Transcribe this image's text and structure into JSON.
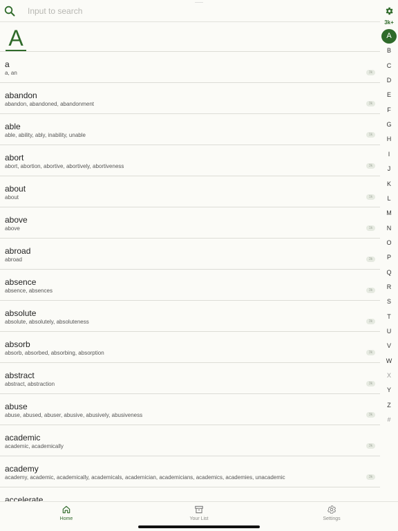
{
  "search": {
    "placeholder": "Input to search"
  },
  "rail": {
    "count": "3k+",
    "letters": [
      "A",
      "B",
      "C",
      "D",
      "E",
      "F",
      "G",
      "H",
      "I",
      "J",
      "K",
      "L",
      "M",
      "N",
      "O",
      "P",
      "Q",
      "R",
      "S",
      "T",
      "U",
      "V",
      "W",
      "X",
      "Y",
      "Z",
      "#"
    ],
    "active_letter": "A",
    "dim_letters": [
      "X",
      "#"
    ]
  },
  "section": {
    "letter": "A"
  },
  "words": [
    {
      "word": "a",
      "forms": "a, an",
      "tag": "3k"
    },
    {
      "word": "abandon",
      "forms": "abandon, abandoned, abandonment",
      "tag": "3k"
    },
    {
      "word": "able",
      "forms": "able, ability, ably, inability, unable",
      "tag": "1k"
    },
    {
      "word": "abort",
      "forms": "abort, abortion, abortive, abortively, abortiveness",
      "tag": "3k"
    },
    {
      "word": "about",
      "forms": "about",
      "tag": "1k"
    },
    {
      "word": "above",
      "forms": "above",
      "tag": "1k"
    },
    {
      "word": "abroad",
      "forms": "abroad",
      "tag": "3k"
    },
    {
      "word": "absence",
      "forms": "absence, absences",
      "tag": "3k"
    },
    {
      "word": "absolute",
      "forms": "absolute, absolutely, absoluteness",
      "tag": "3k"
    },
    {
      "word": "absorb",
      "forms": "absorb, absorbed, absorbing, absorption",
      "tag": "3k"
    },
    {
      "word": "abstract",
      "forms": "abstract, abstraction",
      "tag": "3k"
    },
    {
      "word": "abuse",
      "forms": "abuse, abused, abuser, abusive, abusively, abusiveness",
      "tag": "3k"
    },
    {
      "word": "academic",
      "forms": "academic, academically",
      "tag": "3k"
    },
    {
      "word": "academy",
      "forms": "academy, academic, academically, academicals, academician, academicians, academics, academies, unacademic",
      "tag": "3k"
    },
    {
      "word": "accelerate",
      "forms": "",
      "tag": ""
    }
  ],
  "tabs": [
    {
      "label": "Home",
      "icon": "home-icon",
      "active": true
    },
    {
      "label": "Your List",
      "icon": "archive-icon",
      "active": false
    },
    {
      "label": "Settings",
      "icon": "gear-icon",
      "active": false
    }
  ],
  "colors": {
    "accent": "#2f6a2a",
    "background": "#fbfbf7",
    "divider": "#dcdcd6"
  }
}
